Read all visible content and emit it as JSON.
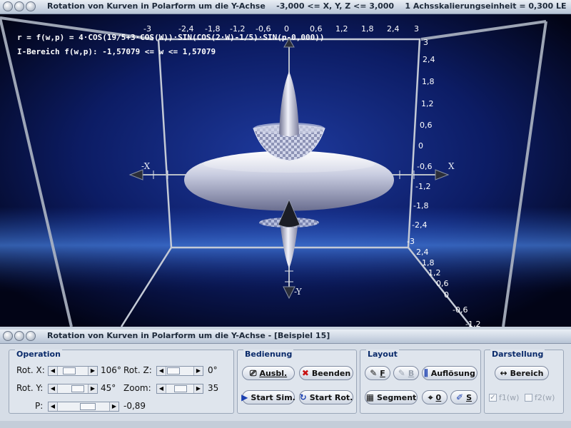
{
  "window": {
    "title_main": "Rotation von Kurven in Polarform um die Y-Achse",
    "title_range": "-3,000 <= X, Y, Z <= 3,000",
    "title_scale": "1 Achsskalierungseinheit = 0,300 LE",
    "title_panel": "Rotation von Kurven in Polarform um die Y-Achse - [Beispiel 15]"
  },
  "scene": {
    "formula": "r = f(w,p) = 4·COS(19/5+3·COS(W))·SIN(COS(2·W)-1/5)·SIN(p-0,000))",
    "range": "I-Bereich f(w,p): -1,57079 <= w <= 1,57079",
    "top_ticks": [
      "-3",
      "-2,4",
      "-1,8",
      "-1,2",
      "-0,6",
      "0",
      "0,6",
      "1,2",
      "1,8",
      "2,4",
      "3"
    ],
    "right_ticks": [
      "3",
      "2,4",
      "1,8",
      "1,2",
      "0,6",
      "0",
      "-0,6",
      "-1,2",
      "-1,8",
      "-2,4",
      "-3"
    ],
    "lower_ticks": [
      "2,4",
      "1,8",
      "1,2",
      "0,6",
      "0",
      "-0,6",
      "-1,2"
    ],
    "axis_x_left": "-X",
    "axis_x_right": "X",
    "axis_y_bottom": "-Y"
  },
  "operation": {
    "title": "Operation",
    "rotx_label": "Rot. X:",
    "rotx_value": "106°",
    "roty_label": "Rot. Y:",
    "roty_value": "45°",
    "p_label": "P:",
    "p_value": "-0,89",
    "rotz_label": "Rot. Z:",
    "rotz_value": "0°",
    "zoom_label": "Zoom:",
    "zoom_value": "35"
  },
  "bedienung": {
    "title": "Bedienung",
    "ausbl": "Ausbl.",
    "beenden": "Beenden",
    "start_sim": "Start Sim.",
    "start_rot": "Start Rot."
  },
  "layout": {
    "title": "Layout",
    "f_btn": "F",
    "b_btn": "B",
    "aufloesung": "Auflösung",
    "segment": "Segment",
    "zero_btn": "0",
    "s_btn": "S"
  },
  "darstellung": {
    "title": "Darstellung",
    "bereich": "Bereich",
    "f1": "f1(w)",
    "f2": "f2(w)",
    "f1_checked": true,
    "f2_checked": false
  },
  "icons": [
    "window-menu-icon",
    "minimize-icon",
    "restore-icon",
    "erase-icon",
    "close-x-icon",
    "play-icon",
    "rotate-icon",
    "brush-icon",
    "resolution-icon",
    "grid-icon",
    "crosshair-icon",
    "pencil-icon",
    "range-icon"
  ]
}
